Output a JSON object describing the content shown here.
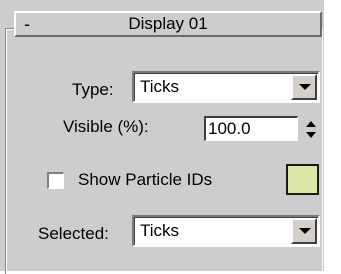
{
  "rollout": {
    "collapse_sign": "-",
    "title": "Display 01"
  },
  "type": {
    "label": "Type:",
    "value": "Ticks"
  },
  "visible": {
    "label": "Visible (%):",
    "value": "100.0"
  },
  "show_particle_ids": {
    "label": "Show Particle IDs",
    "checked": false,
    "color": "#d9e6a6"
  },
  "selected": {
    "label": "Selected:",
    "value": "Ticks"
  },
  "icons": {
    "collapse": "minus-icon",
    "dropdown": "chevron-down-icon",
    "spinner": "spinner-arrows-icon"
  }
}
